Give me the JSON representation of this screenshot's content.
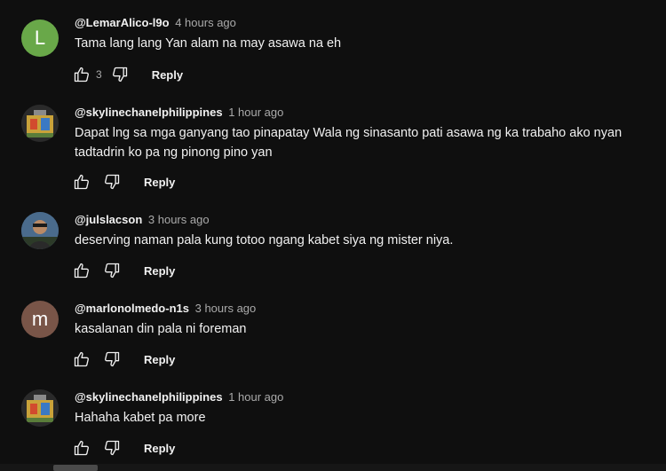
{
  "comments": [
    {
      "author": "@LemarAlico-l9o",
      "time": "4 hours ago",
      "avatar_letter": "L",
      "avatar_color": "#69a849",
      "lines": [
        "Tama lang lang Yan alam na may asawa na eh"
      ],
      "like_count": "3",
      "reply_label": "Reply"
    },
    {
      "author": "@skylinechanelphilippines",
      "time": "1 hour ago",
      "avatar_icon": "profile-photo",
      "lines": [
        "Dapat lng sa mga ganyang tao pinapatay Wala ng sinasanto pati asawa ng ka trabaho ako nyan",
        "tadtadrin ko pa ng pinong pino yan"
      ],
      "reply_label": "Reply"
    },
    {
      "author": "@julslacson",
      "time": "3 hours ago",
      "avatar_icon": "profile-photo",
      "lines": [
        "deserving naman pala kung totoo ngang kabet siya ng mister niya."
      ],
      "reply_label": "Reply"
    },
    {
      "author": "@marlonolmedo-n1s",
      "time": "3 hours ago",
      "avatar_letter": "m",
      "avatar_color": "#795548",
      "lines": [
        "kasalanan din pala ni foreman"
      ],
      "reply_label": "Reply"
    },
    {
      "author": "@skylinechanelphilippines",
      "time": "1 hour ago",
      "avatar_icon": "profile-photo",
      "lines": [
        "Hahaha kabet pa more"
      ],
      "reply_label": "Reply"
    }
  ],
  "icons": {
    "like": "thumbs-up-icon",
    "dislike": "thumbs-down-icon"
  }
}
